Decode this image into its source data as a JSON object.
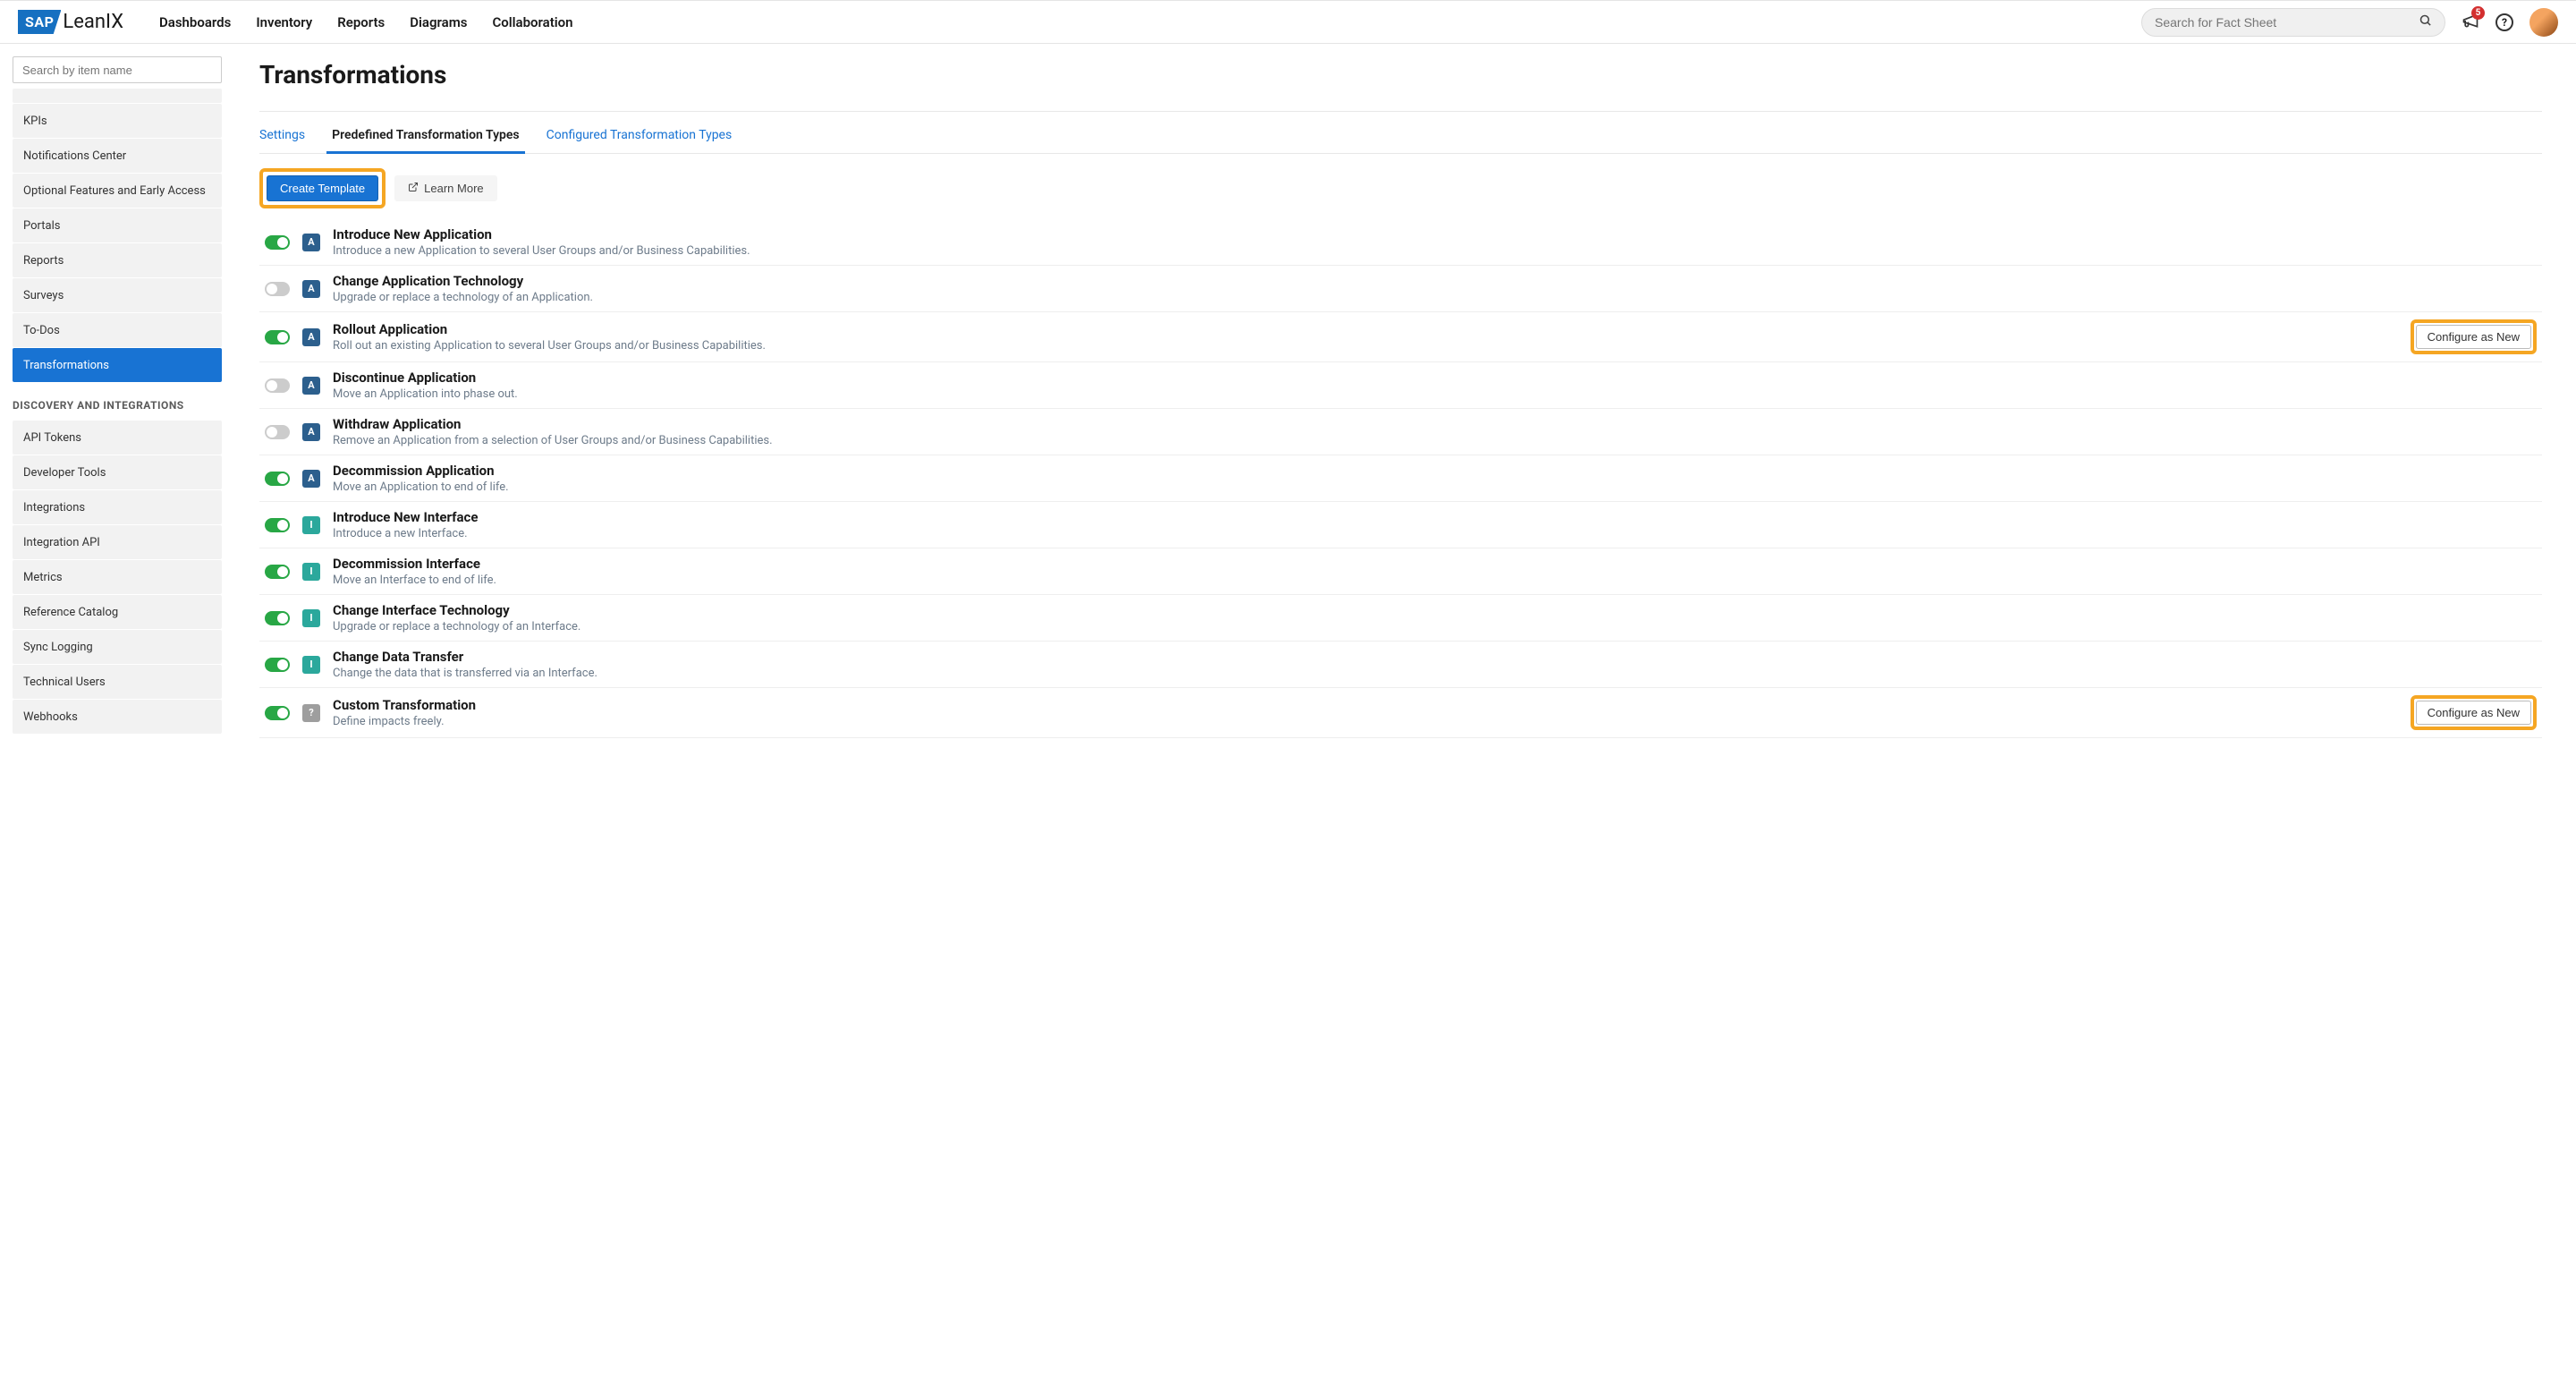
{
  "nav": {
    "logo_sap": "SAP",
    "logo_leanix": "LeanIX",
    "links": [
      "Dashboards",
      "Inventory",
      "Reports",
      "Diagrams",
      "Collaboration"
    ],
    "search_placeholder": "Search for Fact Sheet",
    "badge_count": "5"
  },
  "sidebar": {
    "search_placeholder": "Search by item name",
    "items_top": [
      "KPIs",
      "Notifications Center",
      "Optional Features and Early Access",
      "Portals",
      "Reports",
      "Surveys",
      "To-Dos",
      "Transformations"
    ],
    "section_label": "DISCOVERY AND INTEGRATIONS",
    "items_bottom": [
      "API Tokens",
      "Developer Tools",
      "Integrations",
      "Integration API",
      "Metrics",
      "Reference Catalog",
      "Sync Logging",
      "Technical Users",
      "Webhooks"
    ],
    "active": "Transformations"
  },
  "page": {
    "title": "Transformations",
    "tabs": [
      "Settings",
      "Predefined Transformation Types",
      "Configured Transformation Types"
    ],
    "active_tab": "Predefined Transformation Types",
    "actions": {
      "create": "Create Template",
      "learn": "Learn More"
    },
    "configure_label": "Configure as New",
    "rows": [
      {
        "on": true,
        "badge": "A",
        "title": "Introduce New Application",
        "desc": "Introduce a new Application to several User Groups and/or Business Capabilities.",
        "highlight": false
      },
      {
        "on": false,
        "badge": "A",
        "title": "Change Application Technology",
        "desc": "Upgrade or replace a technology of an Application.",
        "highlight": false
      },
      {
        "on": true,
        "badge": "A",
        "title": "Rollout Application",
        "desc": "Roll out an existing Application to several User Groups and/or Business Capabilities.",
        "highlight": true
      },
      {
        "on": false,
        "badge": "A",
        "title": "Discontinue Application",
        "desc": "Move an Application into phase out.",
        "highlight": false
      },
      {
        "on": false,
        "badge": "A",
        "title": "Withdraw Application",
        "desc": "Remove an Application from a selection of User Groups and/or Business Capabilities.",
        "highlight": false
      },
      {
        "on": true,
        "badge": "A",
        "title": "Decommission Application",
        "desc": "Move an Application to end of life.",
        "highlight": false
      },
      {
        "on": true,
        "badge": "I",
        "title": "Introduce New Interface",
        "desc": "Introduce a new Interface.",
        "highlight": false
      },
      {
        "on": true,
        "badge": "I",
        "title": "Decommission Interface",
        "desc": "Move an Interface to end of life.",
        "highlight": false
      },
      {
        "on": true,
        "badge": "I",
        "title": "Change Interface Technology",
        "desc": "Upgrade or replace a technology of an Interface.",
        "highlight": false
      },
      {
        "on": true,
        "badge": "I",
        "title": "Change Data Transfer",
        "desc": "Change the data that is transferred via an Interface.",
        "highlight": false
      },
      {
        "on": true,
        "badge": "?",
        "title": "Custom Transformation",
        "desc": "Define impacts freely.",
        "highlight": true
      }
    ]
  }
}
